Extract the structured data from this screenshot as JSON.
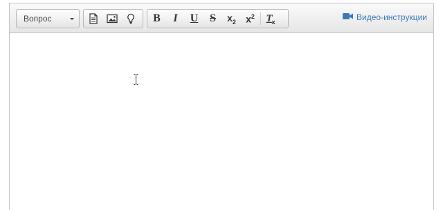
{
  "toolbar": {
    "format_select": {
      "value": "Вопрос"
    },
    "insert_group": {
      "icons": [
        "document-icon",
        "image-icon",
        "lightbulb-icon"
      ]
    },
    "format_group": {
      "bold_label": "B",
      "italic_label": "I",
      "underline_label": "U",
      "strike_label": "S",
      "subscript_base": "x",
      "subscript_index": "2",
      "superscript_base": "x",
      "superscript_index": "2",
      "clear_label": "T",
      "clear_sub": "x"
    },
    "video_link": {
      "label": "Видео-инструкции",
      "icon": "video-camera-icon",
      "color": "#3b7ab8"
    }
  },
  "editor": {
    "content": "",
    "cursor": "text-cursor-icon"
  }
}
